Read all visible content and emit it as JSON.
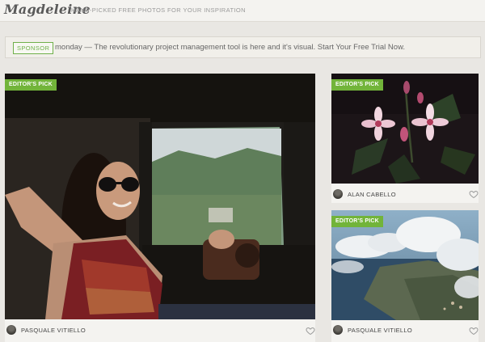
{
  "header": {
    "logo": "Magdeleine",
    "tagline": "HAND-PICKED FREE PHOTOS FOR YOUR INSPIRATION"
  },
  "sponsor": {
    "badge": "SPONSOR",
    "text": "monday — The revolutionary project management tool is here and it's visual. Start Your Free Trial Now."
  },
  "cards": [
    {
      "badge": "EDITOR'S PICK",
      "author": "PASQUALE VITIELLO",
      "photo": "woman-in-car-photo",
      "icon": "heart-icon"
    },
    {
      "badge": "EDITOR'S PICK",
      "author": "ALAN CABELLO",
      "photo": "pink-flowers-photo",
      "icon": "heart-icon"
    },
    {
      "badge": "EDITOR'S PICK",
      "author": "PASQUALE VITIELLO",
      "photo": "aerial-clouds-lake-photo",
      "icon": "heart-icon"
    }
  ],
  "colors": {
    "accent": "#72b43a",
    "background": "#e9e7e3"
  }
}
